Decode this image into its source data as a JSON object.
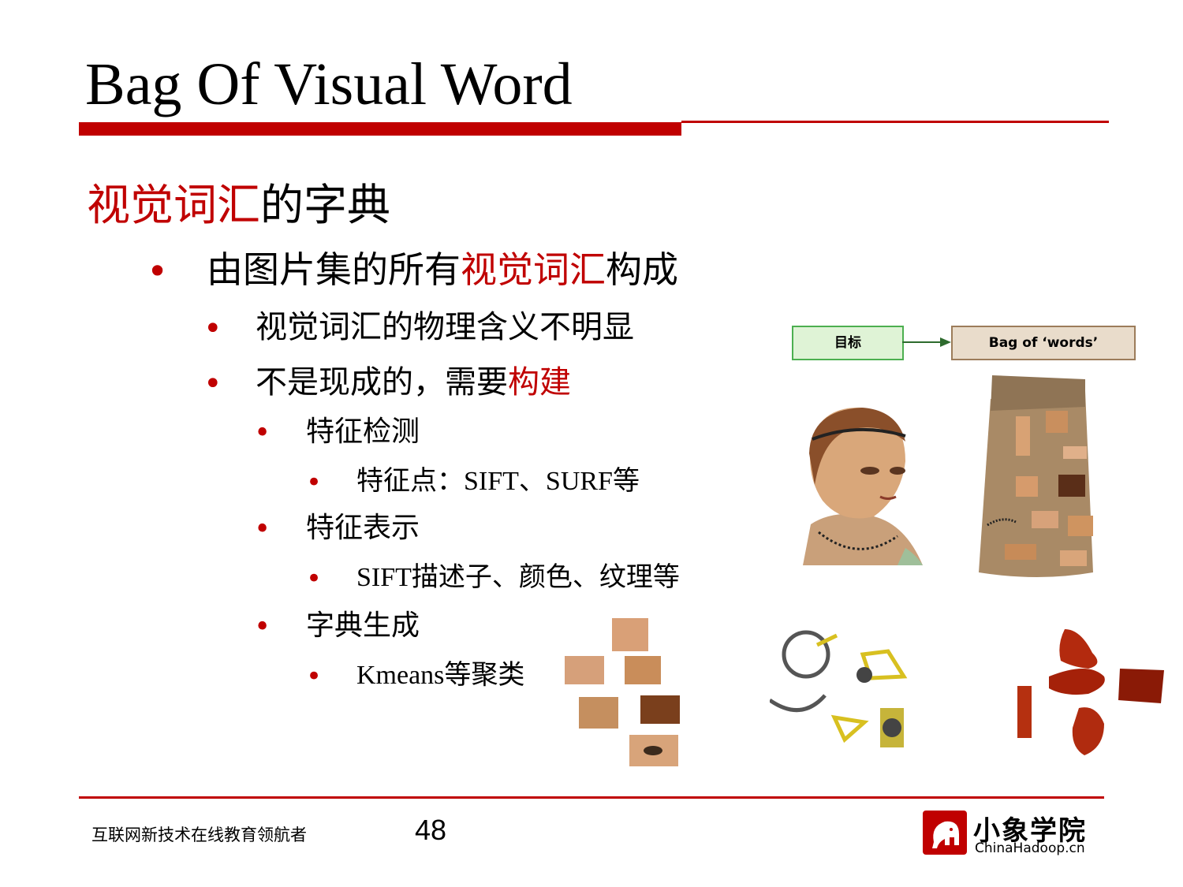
{
  "slide": {
    "title": "Bag Of Visual Word",
    "heading_red": "视觉词汇",
    "heading_rest": "的字典",
    "bullet_glyph": "•"
  },
  "bullets": {
    "b1_pre": "由图片集的所有",
    "b1_red": "视觉词汇",
    "b1_post": "构成",
    "b2": "视觉词汇的物理含义不明显",
    "b3_pre": "不是现成的，需要",
    "b3_red": "构建",
    "b4": "特征检测",
    "b5": "特征点：SIFT、SURF等",
    "b6": "特征表示",
    "b7": "SIFT描述子、颜色、纹理等",
    "b8": "字典生成",
    "b9": "Kmeans等聚类"
  },
  "diagram": {
    "box_target": "目标",
    "box_bag": "Bag of ‘words’"
  },
  "footer": {
    "tagline": "互联网新技术在线教育领航者",
    "page_number": "48",
    "logo_name": "小象学院",
    "logo_sub": "ChinaHadoop.cn"
  },
  "colors": {
    "accent_red": "#c00000"
  }
}
